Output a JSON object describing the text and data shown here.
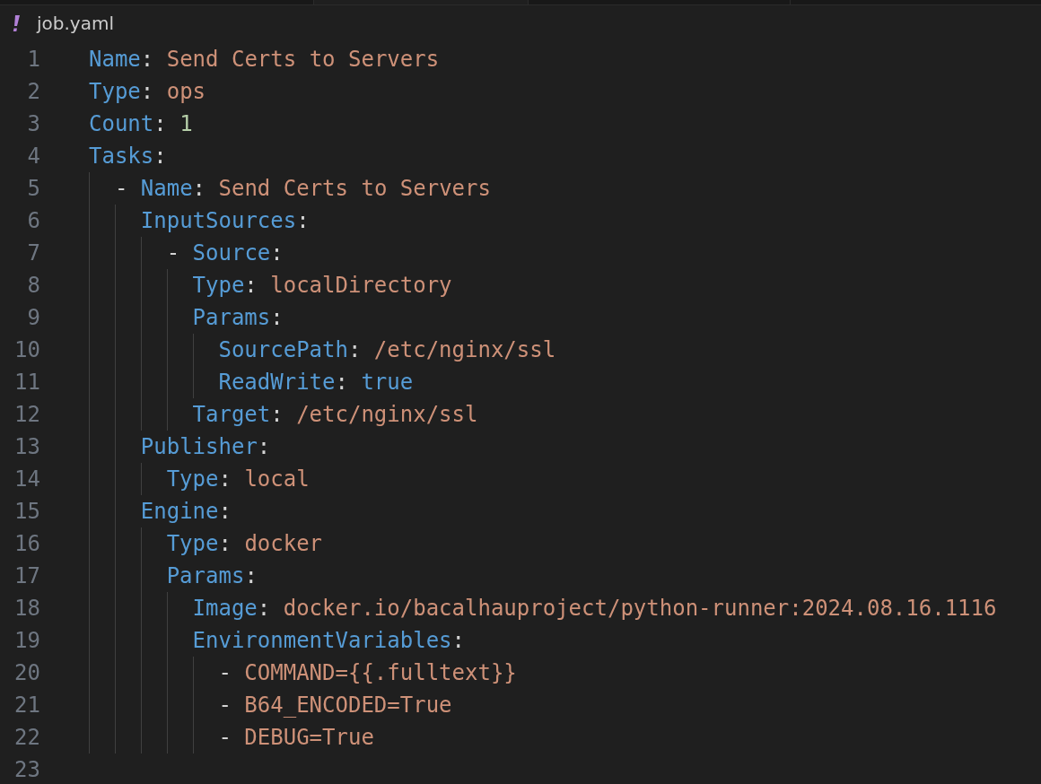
{
  "breadcrumb": {
    "file_name": "job.yaml"
  },
  "editor": {
    "lines": [
      {
        "number": "1",
        "tokens": [
          {
            "kind": "key",
            "text": "Name"
          },
          {
            "kind": "punct",
            "text": ": "
          },
          {
            "kind": "string",
            "text": "Send Certs to Servers"
          }
        ]
      },
      {
        "number": "2",
        "tokens": [
          {
            "kind": "key",
            "text": "Type"
          },
          {
            "kind": "punct",
            "text": ": "
          },
          {
            "kind": "string",
            "text": "ops"
          }
        ]
      },
      {
        "number": "3",
        "tokens": [
          {
            "kind": "key",
            "text": "Count"
          },
          {
            "kind": "punct",
            "text": ": "
          },
          {
            "kind": "number",
            "text": "1"
          }
        ]
      },
      {
        "number": "4",
        "tokens": [
          {
            "kind": "key",
            "text": "Tasks"
          },
          {
            "kind": "punct",
            "text": ":"
          }
        ],
        "children": [
          {
            "number": "5",
            "tokens": [
              {
                "kind": "punct",
                "text": "- "
              },
              {
                "kind": "key",
                "text": "Name"
              },
              {
                "kind": "punct",
                "text": ": "
              },
              {
                "kind": "string",
                "text": "Send Certs to Servers"
              }
            ],
            "children": [
              {
                "number": "6",
                "tokens": [
                  {
                    "kind": "key",
                    "text": "InputSources"
                  },
                  {
                    "kind": "punct",
                    "text": ":"
                  }
                ],
                "children": [
                  {
                    "number": "7",
                    "tokens": [
                      {
                        "kind": "punct",
                        "text": "- "
                      },
                      {
                        "kind": "key",
                        "text": "Source"
                      },
                      {
                        "kind": "punct",
                        "text": ":"
                      }
                    ],
                    "children": [
                      {
                        "number": "8",
                        "tokens": [
                          {
                            "kind": "key",
                            "text": "Type"
                          },
                          {
                            "kind": "punct",
                            "text": ": "
                          },
                          {
                            "kind": "string",
                            "text": "localDirectory"
                          }
                        ]
                      },
                      {
                        "number": "9",
                        "tokens": [
                          {
                            "kind": "key",
                            "text": "Params"
                          },
                          {
                            "kind": "punct",
                            "text": ":"
                          }
                        ],
                        "children": [
                          {
                            "number": "10",
                            "tokens": [
                              {
                                "kind": "key",
                                "text": "SourcePath"
                              },
                              {
                                "kind": "punct",
                                "text": ": "
                              },
                              {
                                "kind": "string",
                                "text": "/etc/nginx/ssl"
                              }
                            ]
                          },
                          {
                            "number": "11",
                            "tokens": [
                              {
                                "kind": "key",
                                "text": "ReadWrite"
                              },
                              {
                                "kind": "punct",
                                "text": ": "
                              },
                              {
                                "kind": "keyword",
                                "text": "true"
                              }
                            ]
                          }
                        ]
                      },
                      {
                        "number": "12",
                        "tokens": [
                          {
                            "kind": "key",
                            "text": "Target"
                          },
                          {
                            "kind": "punct",
                            "text": ": "
                          },
                          {
                            "kind": "string",
                            "text": "/etc/nginx/ssl"
                          }
                        ]
                      }
                    ]
                  }
                ]
              },
              {
                "number": "13",
                "tokens": [
                  {
                    "kind": "key",
                    "text": "Publisher"
                  },
                  {
                    "kind": "punct",
                    "text": ":"
                  }
                ],
                "children": [
                  {
                    "number": "14",
                    "tokens": [
                      {
                        "kind": "key",
                        "text": "Type"
                      },
                      {
                        "kind": "punct",
                        "text": ": "
                      },
                      {
                        "kind": "string",
                        "text": "local"
                      }
                    ]
                  }
                ]
              },
              {
                "number": "15",
                "tokens": [
                  {
                    "kind": "key",
                    "text": "Engine"
                  },
                  {
                    "kind": "punct",
                    "text": ":"
                  }
                ],
                "children": [
                  {
                    "number": "16",
                    "tokens": [
                      {
                        "kind": "key",
                        "text": "Type"
                      },
                      {
                        "kind": "punct",
                        "text": ": "
                      },
                      {
                        "kind": "string",
                        "text": "docker"
                      }
                    ]
                  },
                  {
                    "number": "17",
                    "tokens": [
                      {
                        "kind": "key",
                        "text": "Params"
                      },
                      {
                        "kind": "punct",
                        "text": ":"
                      }
                    ],
                    "children": [
                      {
                        "number": "18",
                        "tokens": [
                          {
                            "kind": "key",
                            "text": "Image"
                          },
                          {
                            "kind": "punct",
                            "text": ": "
                          },
                          {
                            "kind": "string",
                            "text": "docker.io/bacalhauproject/python-runner:2024.08.16.1116"
                          }
                        ]
                      },
                      {
                        "number": "19",
                        "tokens": [
                          {
                            "kind": "key",
                            "text": "EnvironmentVariables"
                          },
                          {
                            "kind": "punct",
                            "text": ":"
                          }
                        ],
                        "children": [
                          {
                            "number": "20",
                            "tokens": [
                              {
                                "kind": "punct",
                                "text": "- "
                              },
                              {
                                "kind": "string",
                                "text": "COMMAND={{.fulltext}}"
                              }
                            ]
                          },
                          {
                            "number": "21",
                            "tokens": [
                              {
                                "kind": "punct",
                                "text": "- "
                              },
                              {
                                "kind": "string",
                                "text": "B64_ENCODED=True"
                              }
                            ]
                          },
                          {
                            "number": "22",
                            "tokens": [
                              {
                                "kind": "punct",
                                "text": "- "
                              },
                              {
                                "kind": "string",
                                "text": "DEBUG=True"
                              }
                            ]
                          }
                        ]
                      }
                    ]
                  }
                ]
              }
            ]
          }
        ]
      },
      {
        "number": "23"
      }
    ]
  }
}
